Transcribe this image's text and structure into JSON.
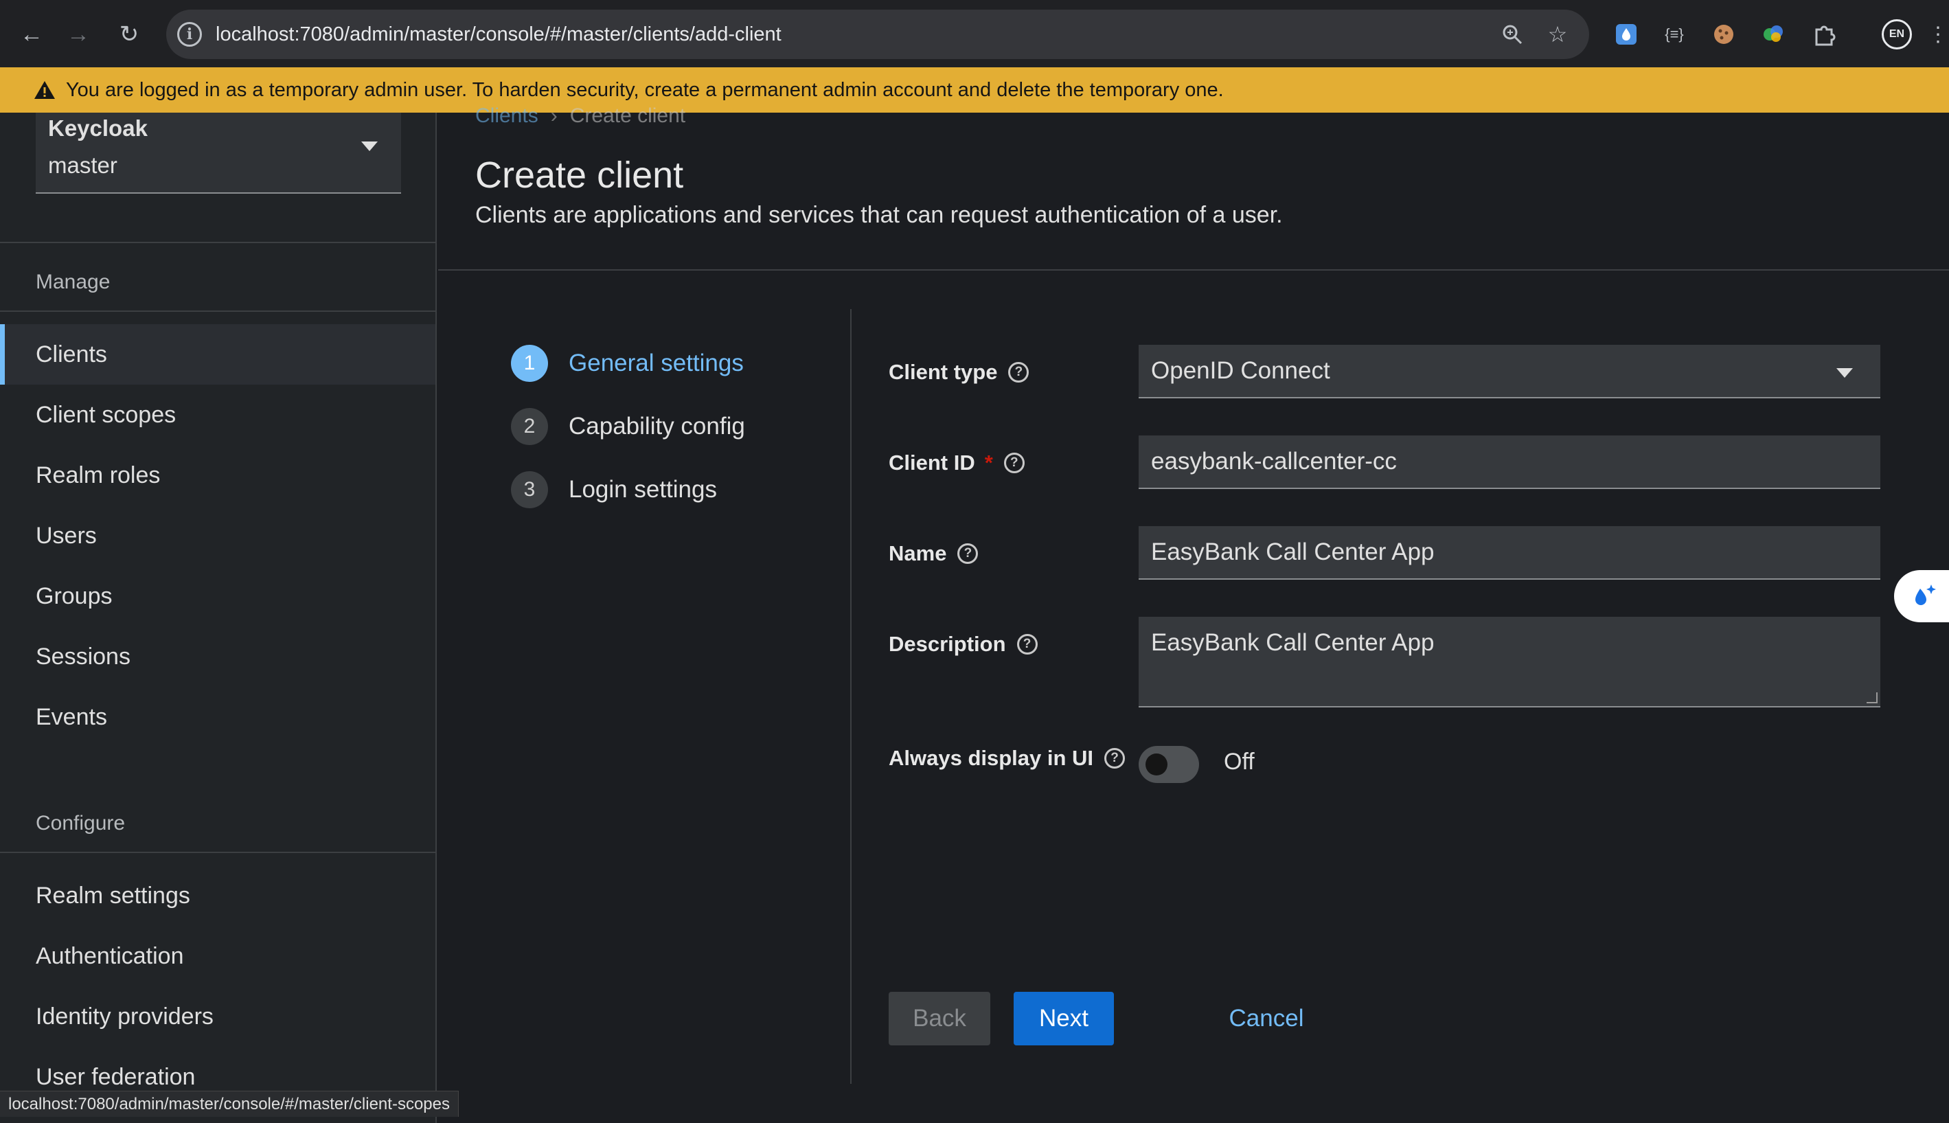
{
  "browser": {
    "url": "localhost:7080/admin/master/console/#/master/clients/add-client",
    "extensions": [
      "droplet-extension-icon",
      "code-braces-extension-icon",
      "cookie-extension-icon",
      "colorful-extension-icon",
      "puzzle-extensions-icon"
    ],
    "profile_label": "EN"
  },
  "banner": {
    "text": "You are logged in as a temporary admin user. To harden security, create a permanent admin account and delete the temporary one."
  },
  "realm": {
    "product": "Keycloak",
    "name": "master"
  },
  "sidebar": {
    "manage_title": "Manage",
    "manage_items": [
      {
        "label": "Clients"
      },
      {
        "label": "Client scopes"
      },
      {
        "label": "Realm roles"
      },
      {
        "label": "Users"
      },
      {
        "label": "Groups"
      },
      {
        "label": "Sessions"
      },
      {
        "label": "Events"
      }
    ],
    "configure_title": "Configure",
    "configure_items": [
      {
        "label": "Realm settings"
      },
      {
        "label": "Authentication"
      },
      {
        "label": "Identity providers"
      },
      {
        "label": "User federation"
      }
    ]
  },
  "breadcrumb": {
    "parent": "Clients",
    "current": "Create client"
  },
  "page": {
    "title": "Create client",
    "subtitle": "Clients are applications and services that can request authentication of a user."
  },
  "wizard": {
    "steps": [
      {
        "number": "1",
        "label": "General settings"
      },
      {
        "number": "2",
        "label": "Capability config"
      },
      {
        "number": "3",
        "label": "Login settings"
      }
    ]
  },
  "form": {
    "client_type": {
      "label": "Client type",
      "value": "OpenID Connect"
    },
    "client_id": {
      "label": "Client ID",
      "required_mark": "*",
      "value": "easybank-callcenter-cc"
    },
    "name": {
      "label": "Name",
      "value": "EasyBank Call Center App"
    },
    "description": {
      "label": "Description",
      "value": "EasyBank Call Center App"
    },
    "always_display": {
      "label": "Always display in UI",
      "state": "Off"
    }
  },
  "actions": {
    "back": "Back",
    "next": "Next",
    "cancel": "Cancel"
  },
  "status_bar": {
    "text": "localhost:7080/admin/master/console/#/master/client-scopes"
  },
  "colors": {
    "banner": "#e3ae34",
    "accent": "#73bcf7",
    "primary_button": "#0f6cd1",
    "required": "#c9190b"
  }
}
